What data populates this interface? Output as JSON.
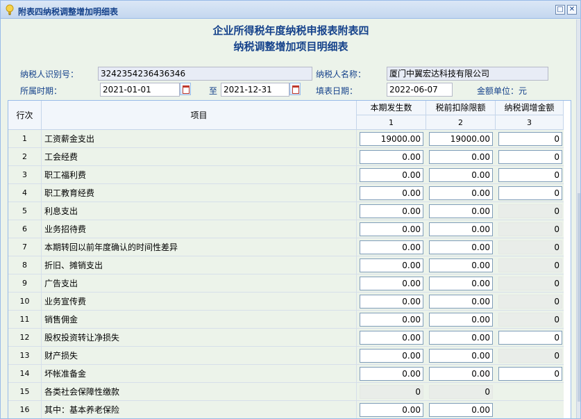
{
  "window": {
    "title": "附表四纳税调整增加明细表",
    "icons": [
      "lightbulb-icon",
      "maximize-icon",
      "close-icon"
    ]
  },
  "header": {
    "title_line1": "企业所得税年度纳税申报表附表四",
    "title_line2": "纳税调整增加项目明细表"
  },
  "form": {
    "taxpayer_id_label": "纳税人识别号：",
    "taxpayer_id": "3242354236436346",
    "taxpayer_name_label": "纳税人名称：",
    "taxpayer_name": "厦门中翼宏达科技有限公司",
    "period_label": "所属时期：",
    "period_from": "2021-01-01",
    "period_to_label": "至",
    "period_to": "2021-12-31",
    "fill_date_label": "填表日期：",
    "fill_date": "2022-06-07",
    "unit_label": "金额单位：元"
  },
  "table": {
    "headers": {
      "no": "行次",
      "item": "项目",
      "col1": "本期发生数",
      "col2": "税前扣除限额",
      "col3": "纳税调增金额",
      "col1_idx": "1",
      "col2_idx": "2",
      "col3_idx": "3"
    },
    "rows": [
      {
        "no": "1",
        "item": "工资薪金支出",
        "v1": "19000.00",
        "v2": "19000.00",
        "v3": "0"
      },
      {
        "no": "2",
        "item": "工会经费",
        "v1": "0.00",
        "v2": "0.00",
        "v3": "0"
      },
      {
        "no": "3",
        "item": "职工福利费",
        "v1": "0.00",
        "v2": "0.00",
        "v3": "0"
      },
      {
        "no": "4",
        "item": "职工教育经费",
        "v1": "0.00",
        "v2": "0.00",
        "v3": "0"
      },
      {
        "no": "5",
        "item": "利息支出",
        "v1": "0.00",
        "v2": "0.00",
        "v3": "0"
      },
      {
        "no": "6",
        "item": "业务招待费",
        "v1": "0.00",
        "v2": "0.00",
        "v3": "0"
      },
      {
        "no": "7",
        "item": "本期转回以前年度确认的时间性差异",
        "v1": "0.00",
        "v2": "0.00",
        "v3": "0"
      },
      {
        "no": "8",
        "item": "折旧、摊销支出",
        "v1": "0.00",
        "v2": "0.00",
        "v3": "0"
      },
      {
        "no": "9",
        "item": "广告支出",
        "v1": "0.00",
        "v2": "0.00",
        "v3": "0"
      },
      {
        "no": "10",
        "item": "业务宣传费",
        "v1": "0.00",
        "v2": "0.00",
        "v3": "0"
      },
      {
        "no": "11",
        "item": "销售佣金",
        "v1": "0.00",
        "v2": "0.00",
        "v3": "0"
      },
      {
        "no": "12",
        "item": "股权投资转让净损失",
        "v1": "0.00",
        "v2": "0.00",
        "v3": "0"
      },
      {
        "no": "13",
        "item": "财产损失",
        "v1": "0.00",
        "v2": "0.00",
        "v3": "0"
      },
      {
        "no": "14",
        "item": "坏帐准备金",
        "v1": "0.00",
        "v2": "0.00",
        "v3": "0"
      },
      {
        "no": "15",
        "item": "各类社会保障性缴款",
        "v1": "0",
        "v2": "0",
        "v3": ""
      },
      {
        "no": "16",
        "item": "其中：基本养老保险",
        "v1": "0.00",
        "v2": "0.00",
        "v3": ""
      }
    ]
  }
}
